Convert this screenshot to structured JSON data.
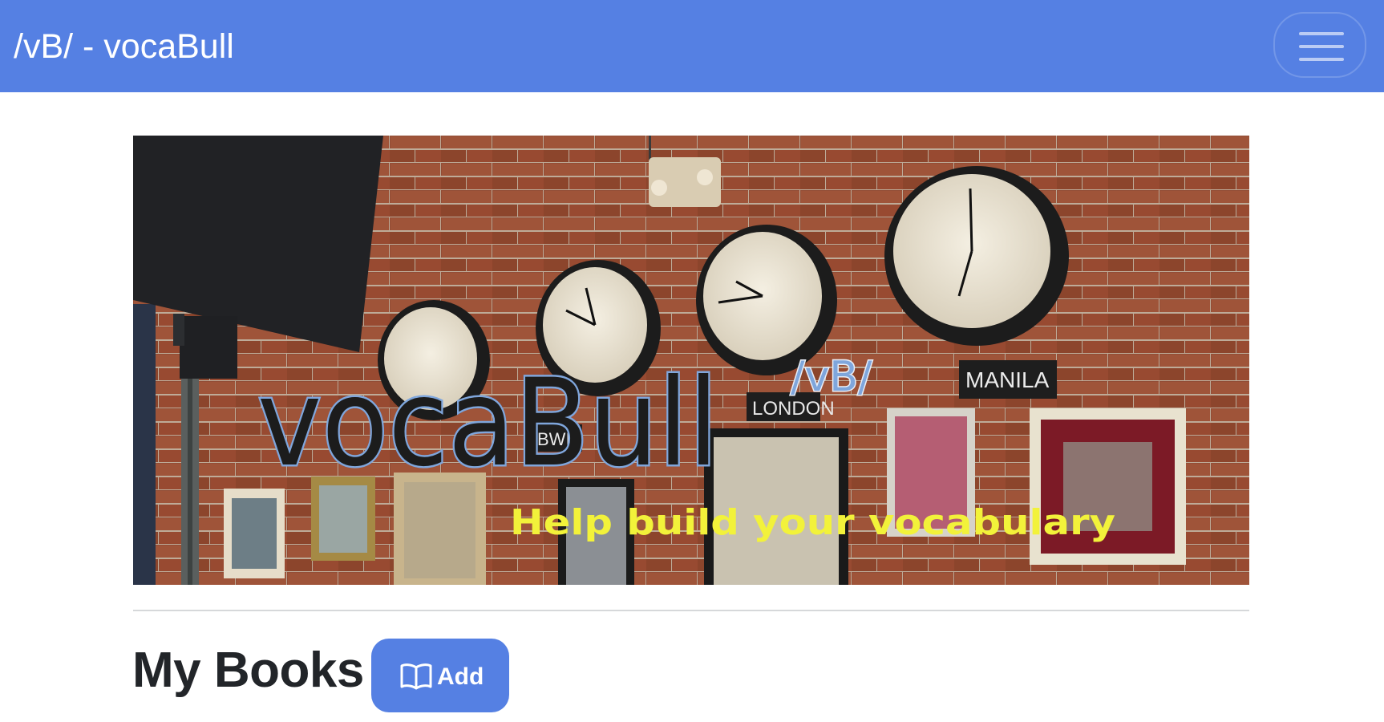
{
  "navbar": {
    "brand": "/vB/ - vocaBull",
    "toggler_icon": "hamburger-menu-icon",
    "background": "#5580e3"
  },
  "banner": {
    "title": "vocaBull",
    "superscript": "/vB/",
    "tagline": "Help build your vocabulary",
    "sign_left": "LONDON",
    "sign_right": "MANILA",
    "sign_small": "BWI"
  },
  "books": {
    "heading": "My Books",
    "add_label": "Add",
    "add_icon": "book-open-icon",
    "button_color": "#5580e3"
  }
}
